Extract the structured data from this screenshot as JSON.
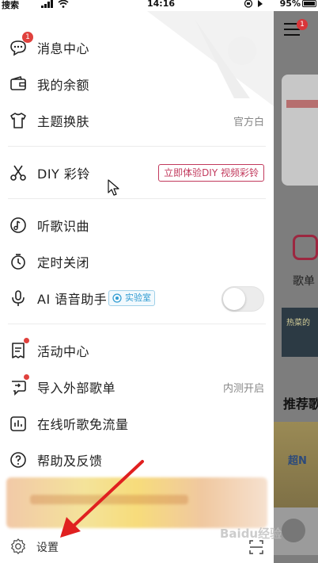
{
  "status_bar": {
    "carrier": "搜索",
    "time": "14:16",
    "battery": "95%"
  },
  "drawer": {
    "message_badge": "1",
    "items": {
      "messages": {
        "label": "消息中心",
        "icon": "chat-bubble-icon"
      },
      "balance": {
        "label": "我的余额",
        "icon": "wallet-icon"
      },
      "theme": {
        "label": "主题换肤",
        "value": "官方白",
        "icon": "tshirt-icon"
      },
      "diy": {
        "label": "DIY 彩铃",
        "tag": "立即体验DIY 视频彩铃",
        "icon": "scissors-icon"
      },
      "recognize": {
        "label": "听歌识曲",
        "icon": "music-recognize-icon"
      },
      "timer": {
        "label": "定时关闭",
        "icon": "timer-icon"
      },
      "ai_assistant": {
        "label": "AI 语音助手",
        "tag": "实验室",
        "icon": "microphone-icon",
        "enabled": false
      },
      "activity": {
        "label": "活动中心",
        "icon": "activity-icon"
      },
      "import": {
        "label": "导入外部歌单",
        "value": "内测开启",
        "icon": "import-playlist-icon"
      },
      "free_data": {
        "label": "在线听歌免流量",
        "icon": "data-chart-icon"
      },
      "help": {
        "label": "帮助及反馈",
        "icon": "help-icon"
      }
    },
    "footer": {
      "settings_label": "设置"
    }
  },
  "background_page": {
    "menu_badge": "1",
    "grid_label": "歌单",
    "section_title": "推荐歌",
    "card2_text": "热菜的",
    "card3_text": "超N"
  },
  "watermark": "Baidu经验",
  "colors": {
    "badge": "#e0413d",
    "diy_tag": "#c23a5d",
    "lab_tag": "#2f9bd1",
    "arrow": "#e02020"
  }
}
